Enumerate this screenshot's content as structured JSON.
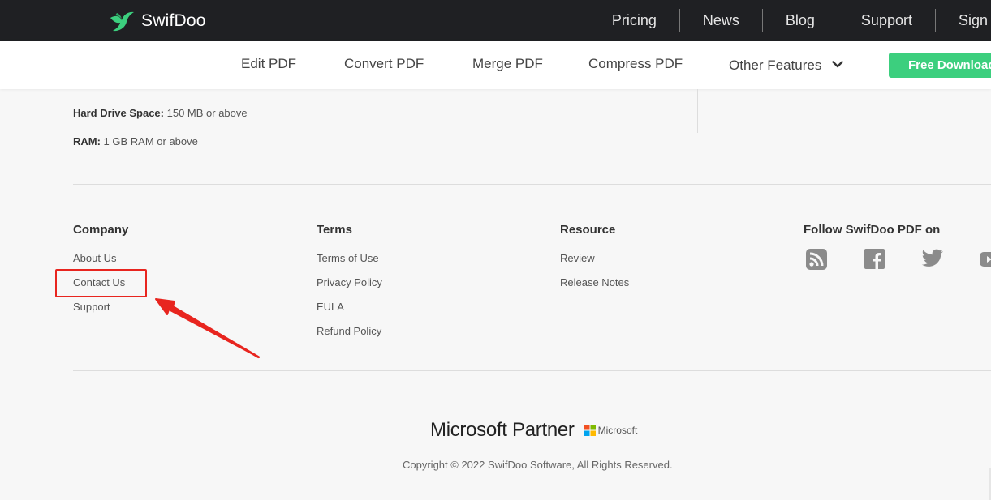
{
  "brand": {
    "name": "SwifDoo",
    "color": "#3ccf7e"
  },
  "top_nav": [
    "Pricing",
    "News",
    "Blog",
    "Support",
    "Sign I"
  ],
  "product_nav": {
    "items": [
      "Edit PDF",
      "Convert PDF",
      "Merge PDF",
      "Compress PDF",
      "Other Features"
    ],
    "download_label": "Free Download",
    "download_color": "#3ccf7e"
  },
  "specs": {
    "hdd_label": "Hard Drive Space:",
    "hdd_value": " 150 MB or above",
    "ram_label": "RAM:",
    "ram_value": " 1 GB RAM or above"
  },
  "footer": {
    "company": {
      "title": "Company",
      "links": [
        "About Us",
        "Contact Us",
        "Support"
      ]
    },
    "terms": {
      "title": "Terms",
      "links": [
        "Terms of Use",
        "Privacy Policy",
        "EULA",
        "Refund Policy"
      ]
    },
    "resource": {
      "title": "Resource",
      "links": [
        "Review",
        "Release Notes"
      ]
    },
    "follow": {
      "title": "Follow SwifDoo PDF on",
      "icons": [
        "rss-icon",
        "facebook-icon",
        "twitter-icon",
        "youtube-icon"
      ]
    }
  },
  "partner": {
    "text": "Microsoft Partner",
    "logo_word": "Microsoft"
  },
  "copyright": "Copyright © 2022 SwifDoo Software, All Rights Reserved.",
  "annotation": {
    "color": "#e8251f",
    "target": "Contact Us"
  }
}
